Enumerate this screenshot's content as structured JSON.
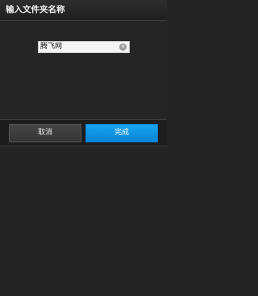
{
  "dialog": {
    "title": "输入文件夹名称"
  },
  "name_input": {
    "value": "腾飞网",
    "clear_icon": "clear-icon"
  },
  "buttons": {
    "cancel_label": "取消",
    "done_label": "完成"
  },
  "colors": {
    "background": "#252525",
    "accent": "#0f96e0",
    "cancel_button": "#3d3d3d"
  }
}
